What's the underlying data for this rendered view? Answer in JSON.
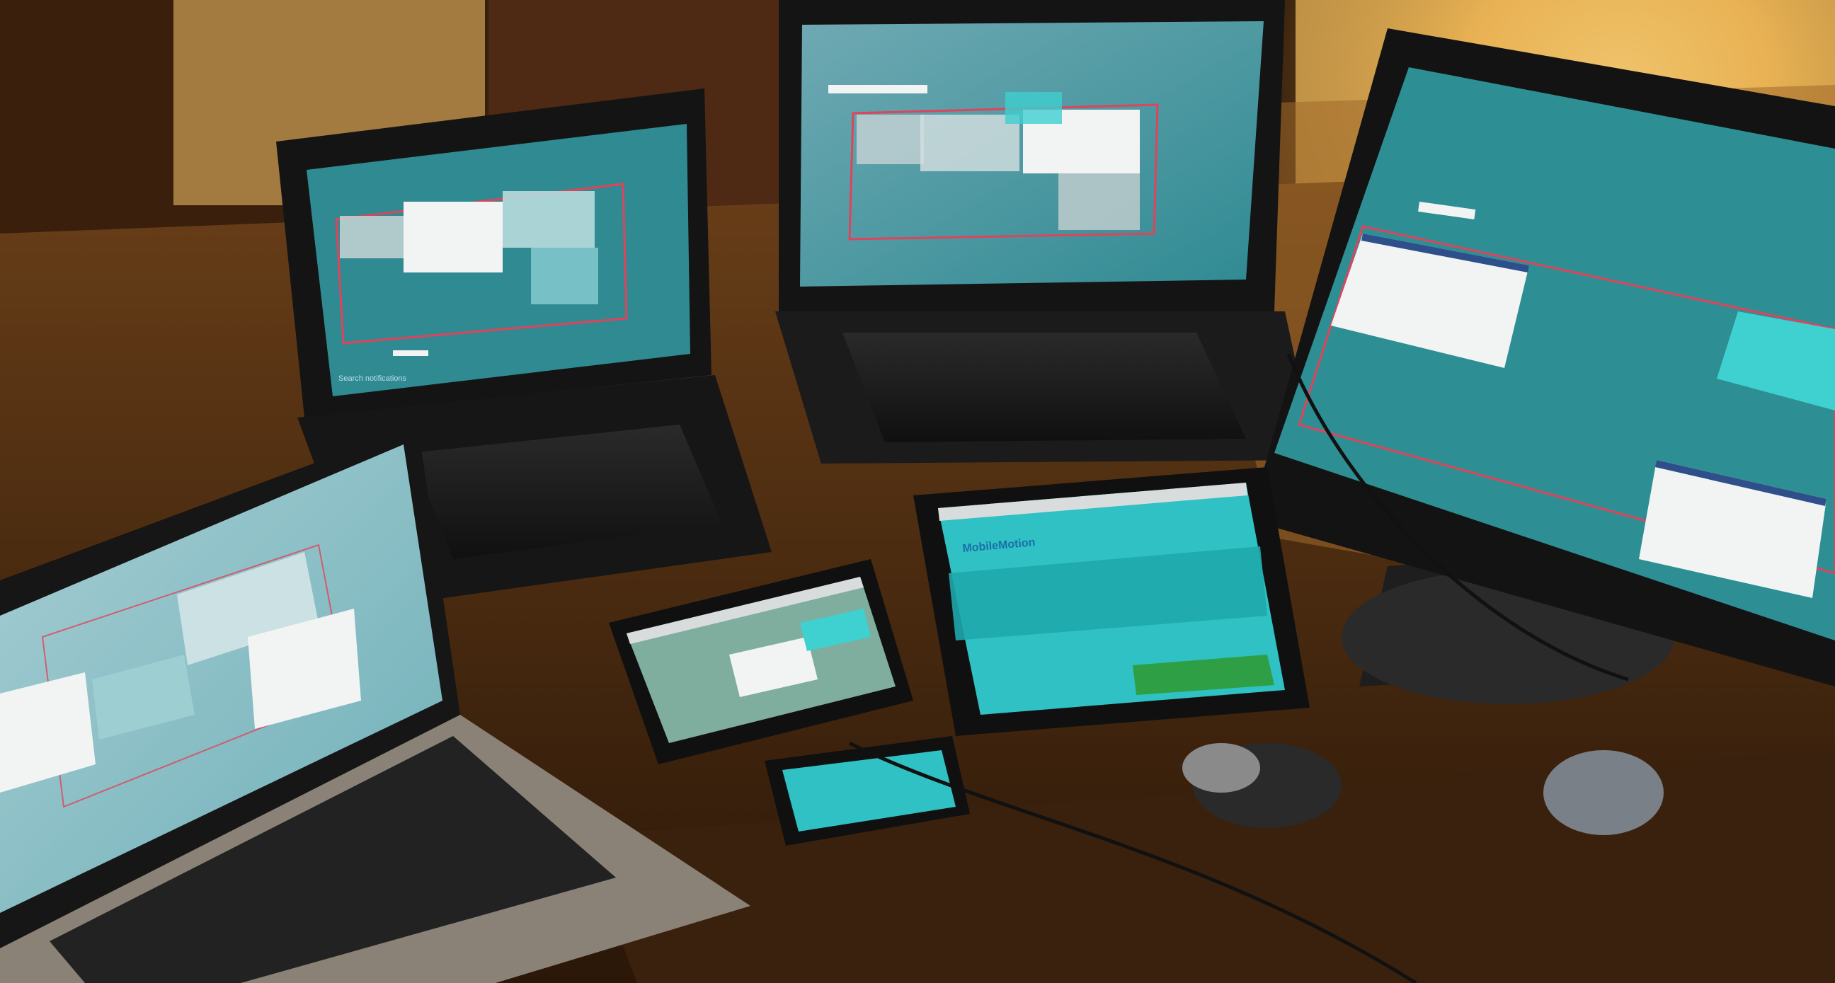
{
  "scene": {
    "description_note": "",
    "devices": [
      {
        "id": "laptop-left-front",
        "kind": "laptop"
      },
      {
        "id": "laptop-back-left",
        "kind": "laptop"
      },
      {
        "id": "laptop-back-center",
        "kind": "laptop"
      },
      {
        "id": "monitor-right",
        "kind": "monitor"
      },
      {
        "id": "tablet-small",
        "kind": "tablet"
      },
      {
        "id": "tablet-large",
        "kind": "tablet"
      },
      {
        "id": "phone",
        "kind": "phone"
      }
    ],
    "screen_text": {
      "tablet_large_heading": "MobileMotion",
      "laptop_back_left_caption": "Search notifications"
    }
  },
  "colors": {
    "wood_dark": "#2a1708",
    "wood_mid": "#5a3515",
    "wood_light": "#8a5a25",
    "lamp_glow": "#f5c86a",
    "screen_teal": "#2d8f94",
    "screen_teal_dark": "#1f6e74",
    "screen_cyan": "#3fd0d0",
    "window_white": "#f2f4f4",
    "window_grey": "#c7d3d4",
    "outline_red": "#e0435a",
    "bezel": "#141414"
  }
}
